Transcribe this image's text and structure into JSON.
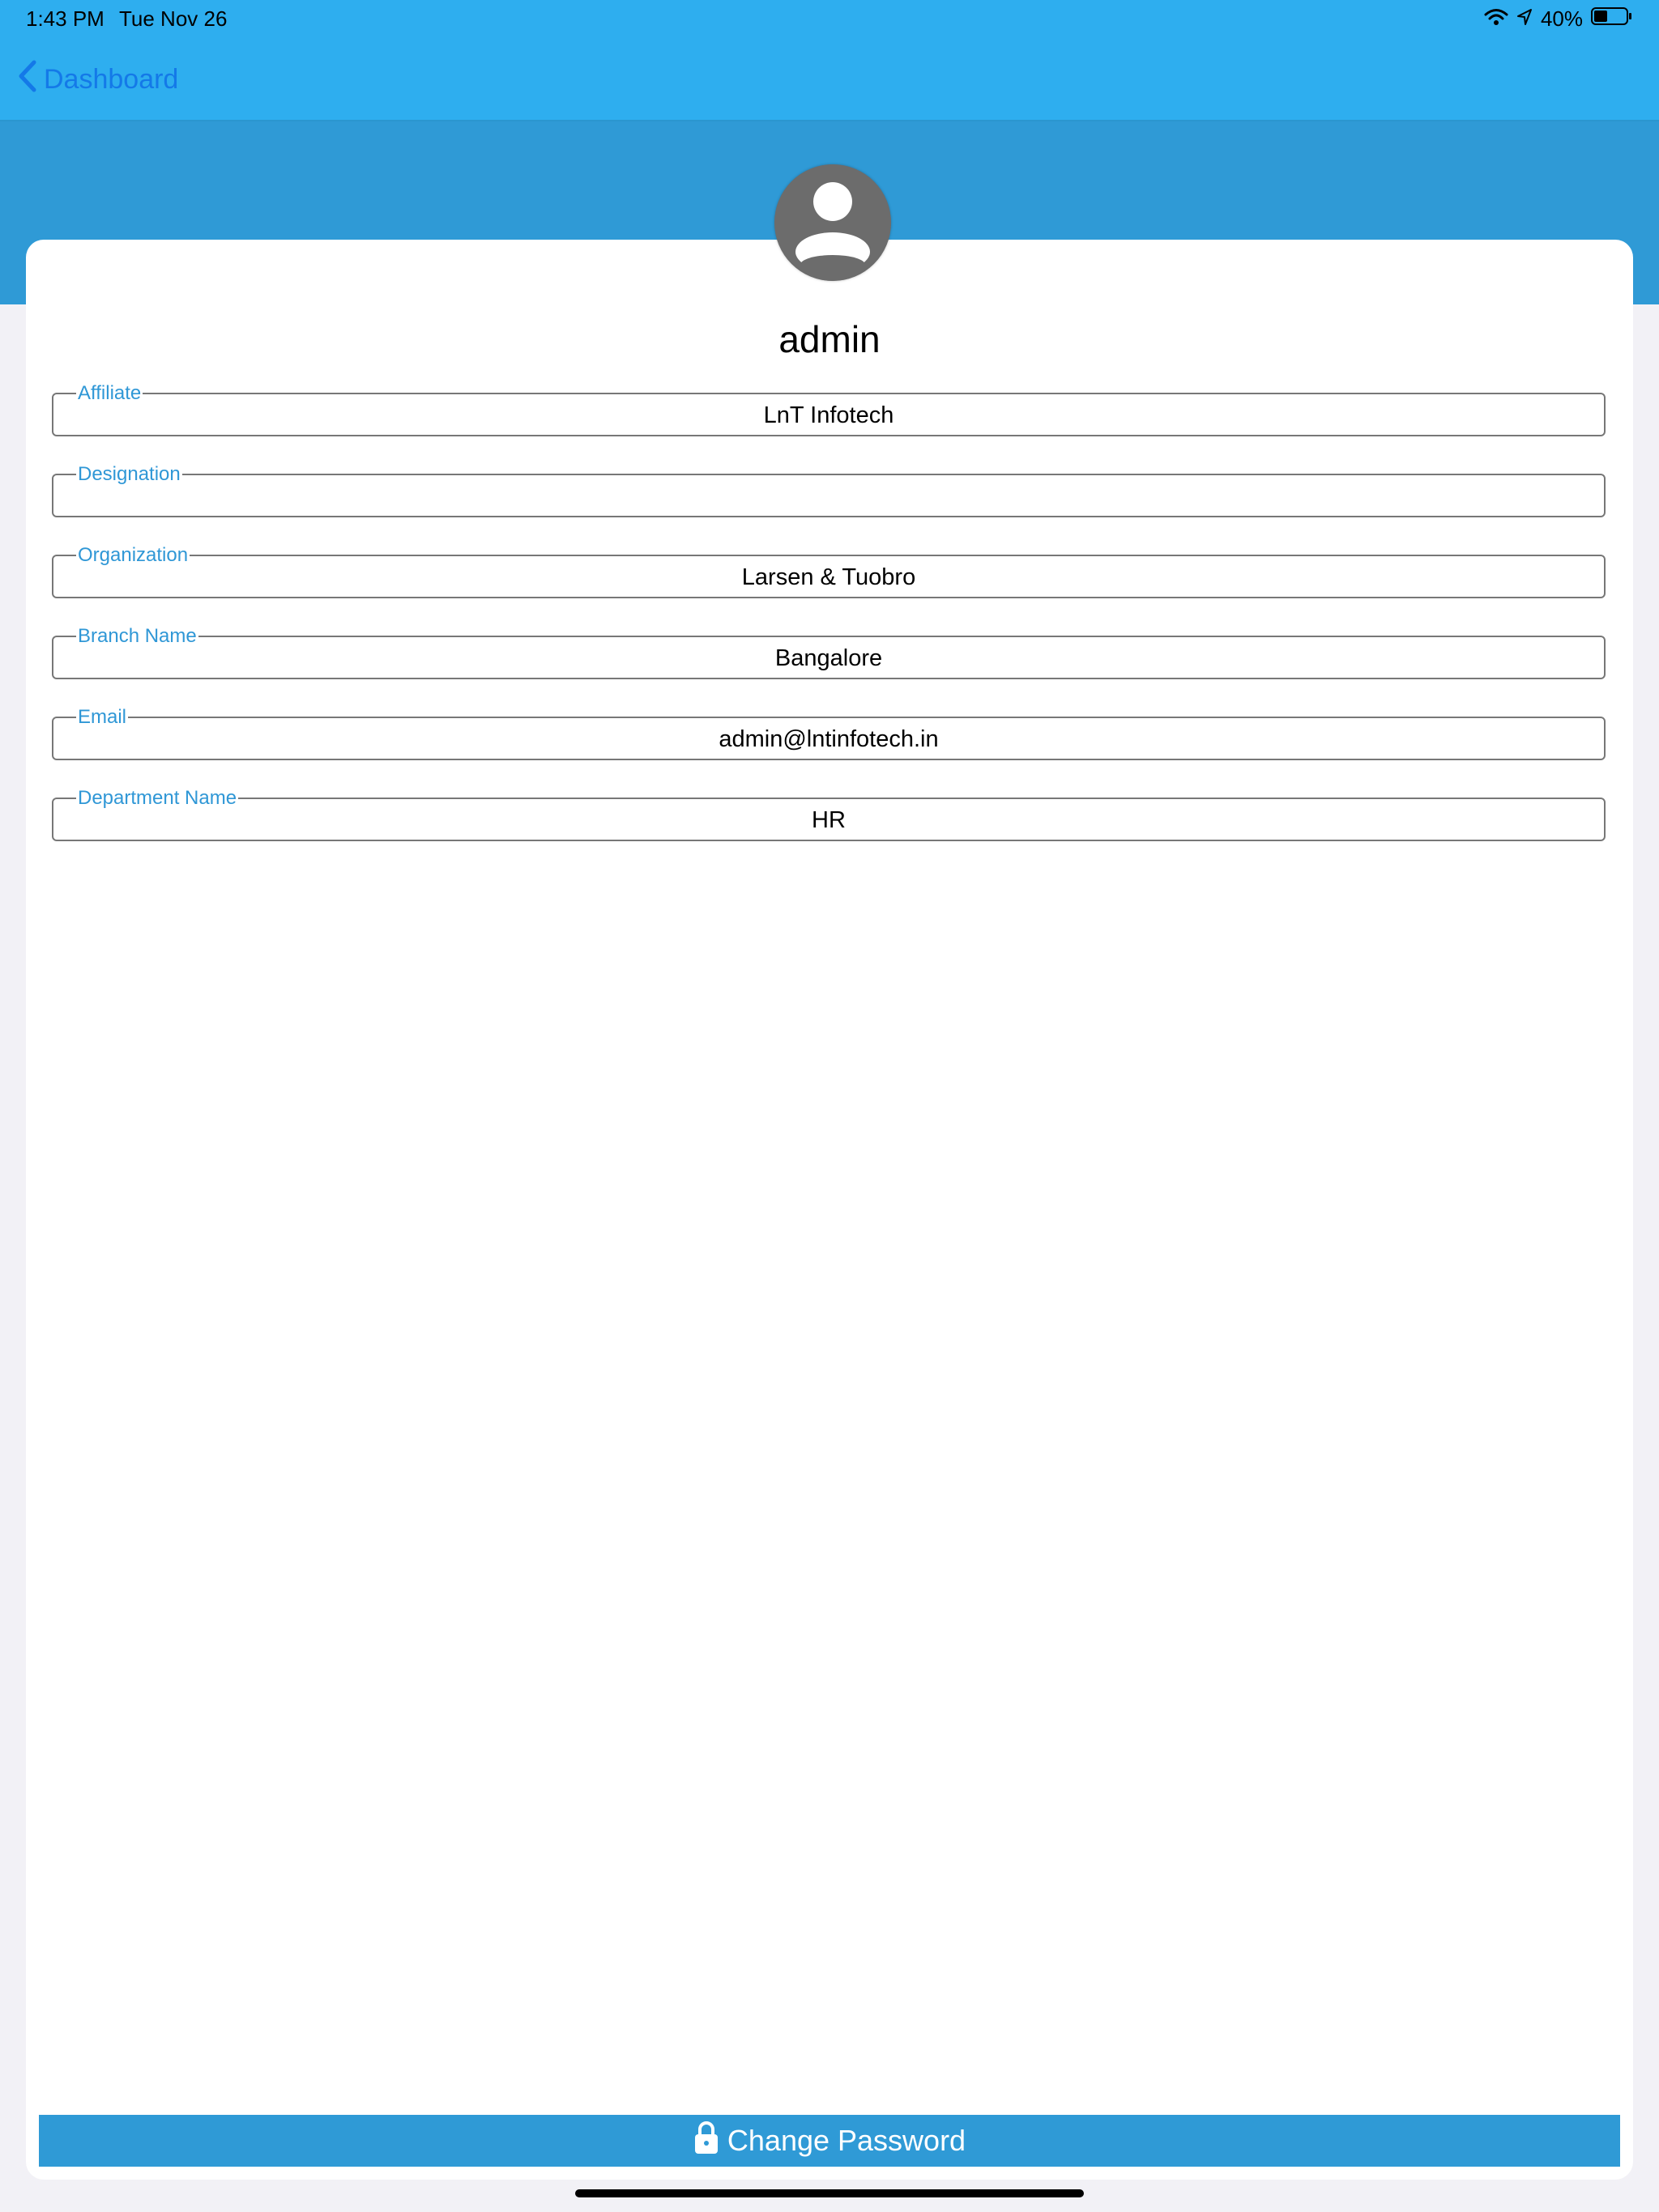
{
  "status_bar": {
    "time": "1:43 PM",
    "date": "Tue Nov 26",
    "battery": "40%",
    "wifi_icon": "wifi-icon",
    "location_icon": "location-arrow-icon",
    "battery_icon": "battery-icon"
  },
  "nav": {
    "back_label": "Dashboard",
    "back_icon": "chevron-left-icon"
  },
  "profile": {
    "avatar_icon": "user-avatar-icon",
    "username": "admin"
  },
  "fields": [
    {
      "label": "Affiliate",
      "value": "LnT Infotech"
    },
    {
      "label": "Designation",
      "value": ""
    },
    {
      "label": "Organization",
      "value": "Larsen & Tuobro"
    },
    {
      "label": "Branch Name",
      "value": "Bangalore"
    },
    {
      "label": "Email",
      "value": "admin@lntinfotech.in"
    },
    {
      "label": "Department Name",
      "value": "HR"
    }
  ],
  "actions": {
    "change_password_label": "Change Password",
    "lock_icon": "lock-icon"
  },
  "colors": {
    "nav_blue": "#2eaeef",
    "header_blue": "#2f9ad6",
    "link_blue": "#1479e8",
    "label_blue": "#2f97d6",
    "avatar_gray": "#6c6c6c",
    "background": "#f2f1f6"
  }
}
